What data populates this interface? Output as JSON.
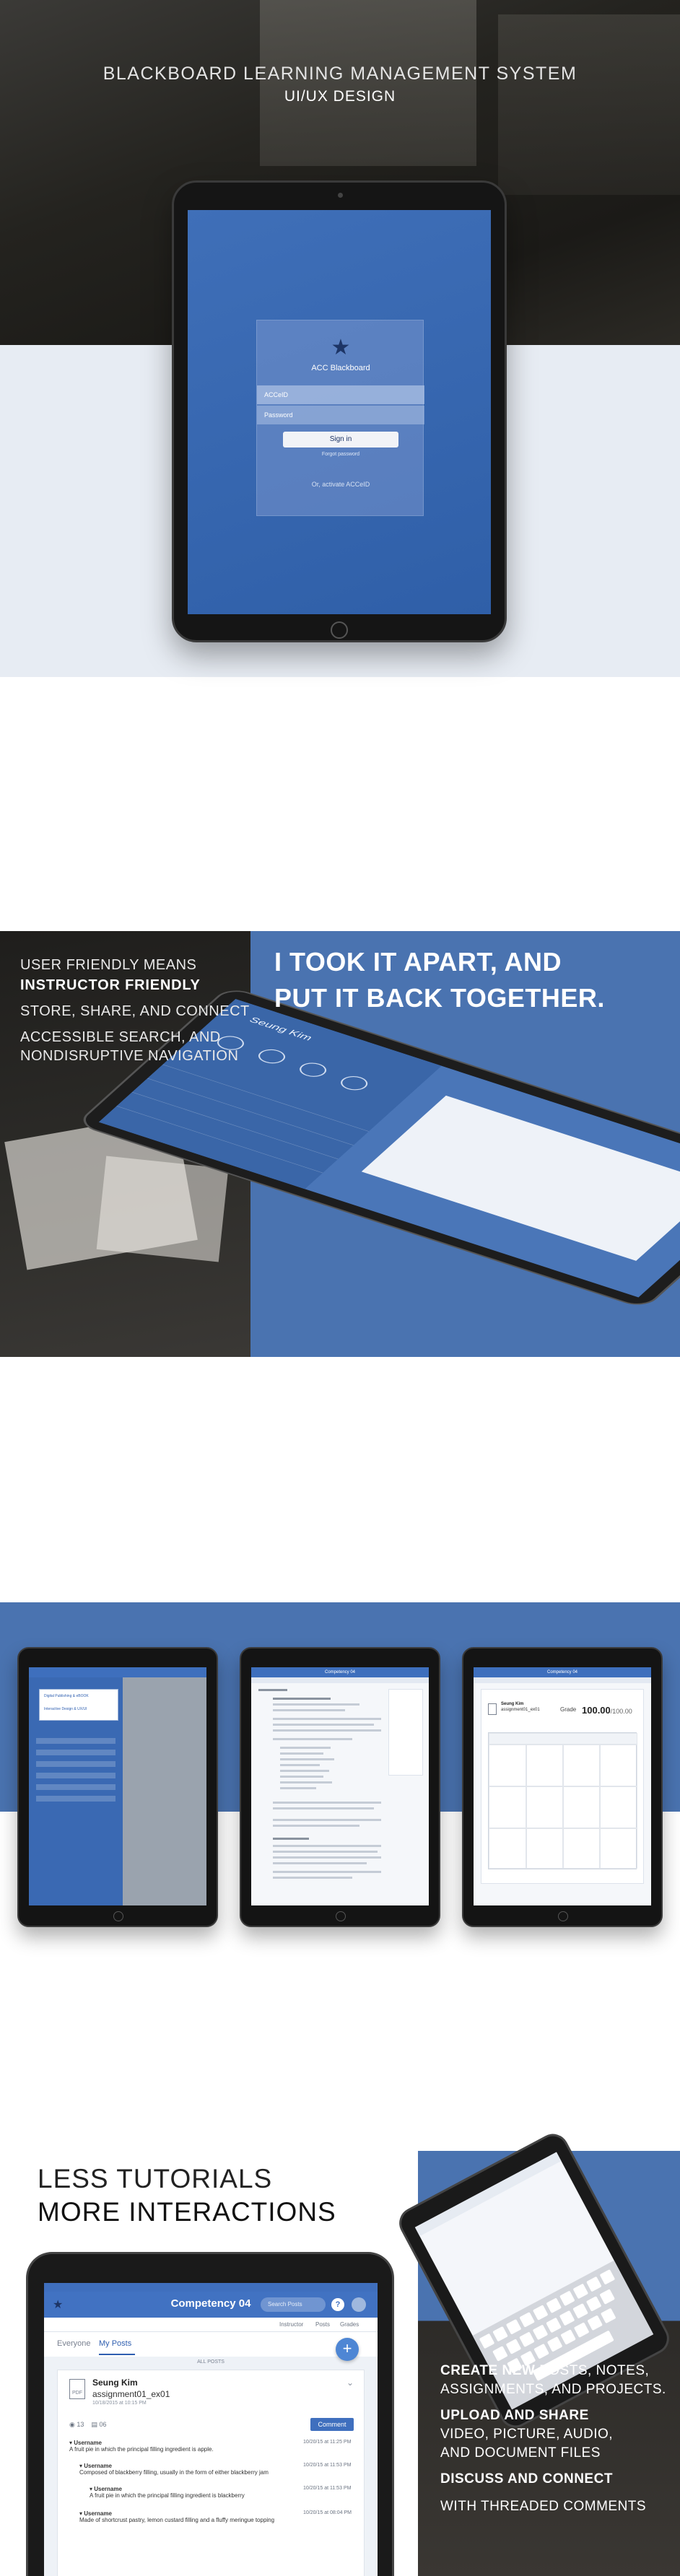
{
  "hero": {
    "title": "BLACKBOARD LEARNING MANAGEMENT SYSTEM",
    "subtitle": "UI/UX DESIGN",
    "login": {
      "brand": "ACC Blackboard",
      "user_placeholder": "ACCeID",
      "pass_placeholder": "Password",
      "sign_in": "Sign in",
      "forgot": "Forgot password",
      "activate": "Or, activate ACCeID"
    }
  },
  "teardown": {
    "lines": [
      {
        "text": "USER FRIENDLY MEANS",
        "bold": false
      },
      {
        "text": "INSTRUCTOR FRIENDLY",
        "bold": true
      },
      {
        "text": "STORE, SHARE, AND CONNECT",
        "bold": false
      },
      {
        "text": "ACCESSIBLE SEARCH, AND",
        "bold": false
      },
      {
        "text": "NONDISRUPTIVE NAVIGATION",
        "bold": false
      }
    ],
    "headline_1": "I TOOK IT APART, AND",
    "headline_2": "PUT IT BACK TOGETHER.",
    "tablet_user": "Seung Kim"
  },
  "tablets": {
    "t1_popup_1": "Digital Publishing & eBOOK",
    "t1_popup_2": "Interactive Design & UX/UI",
    "t2_bar": "Competency 04",
    "t3_bar": "Competency 04",
    "t3_user": "Seung Kim",
    "t3_assign": "assignment01_ex01",
    "t3_grade_label": "Grade",
    "t3_grade_value": "100.00",
    "t3_grade_total": "/100.00"
  },
  "tutorials": {
    "title_1": "LESS TUTORIALS",
    "title_2": "MORE INTERACTIONS",
    "features": [
      {
        "bold": "CREATE NEW",
        "text": " POSTS, NOTES,"
      },
      {
        "bold": "",
        "text": "ASSIGNMENTS, AND PROJECTS."
      },
      {
        "bold": "UPLOAD AND SHARE",
        "text": ""
      },
      {
        "bold": "",
        "text": " VIDEO, PICTURE, AUDIO,"
      },
      {
        "bold": "",
        "text": "AND DOCUMENT FILES"
      },
      {
        "bold": "DISCUSS AND CONNECT",
        "text": ""
      },
      {
        "bold": "",
        "text": "WITH THREADED COMMENTS"
      }
    ],
    "app": {
      "title": "Competency 04",
      "search": "Search Posts",
      "sub_tabs": [
        "Instructor",
        "Posts",
        "Grades"
      ],
      "tabs": [
        "Everyone",
        "My Posts"
      ],
      "all_posts": "ALL POSTS",
      "post_user": "Seung Kim",
      "post_assign": "assignment01_ex01",
      "post_meta": "10/18/2015 at 10:15 PM",
      "likes": "13",
      "comments": "06",
      "comment_btn": "Comment",
      "thread": [
        {
          "user": "Username",
          "time": "10/20/15 at 11:25 PM",
          "text": "A fruit pie in which the principal filling ingredient is apple."
        },
        {
          "user": "Username",
          "time": "10/20/15 at 11:53 PM",
          "text": "Composed of blackberry filling, usually in the form of either blackberry jam"
        },
        {
          "user": "Username",
          "time": "10/20/15 at 11:53 PM",
          "text": "A fruit pie in which the principal filling ingredient is blackberry"
        },
        {
          "user": "Username",
          "time": "10/20/15 at 08:04 PM",
          "text": "Made of shortcrust pastry, lemon custard filling and a fluffy meringue topping"
        }
      ]
    }
  }
}
